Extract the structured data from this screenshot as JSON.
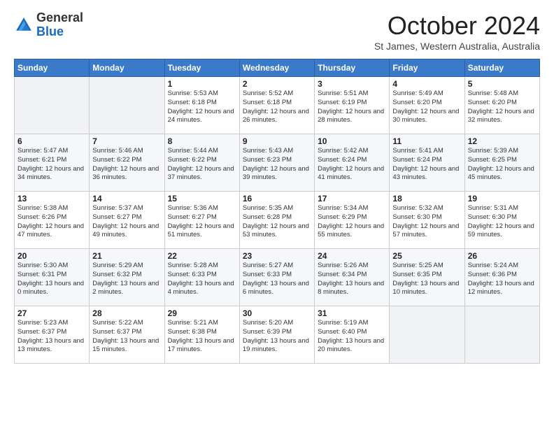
{
  "logo": {
    "general": "General",
    "blue": "Blue"
  },
  "title": "October 2024",
  "location": "St James, Western Australia, Australia",
  "days_header": [
    "Sunday",
    "Monday",
    "Tuesday",
    "Wednesday",
    "Thursday",
    "Friday",
    "Saturday"
  ],
  "weeks": [
    [
      {
        "day": "",
        "info": ""
      },
      {
        "day": "",
        "info": ""
      },
      {
        "day": "1",
        "info": "Sunrise: 5:53 AM\nSunset: 6:18 PM\nDaylight: 12 hours\nand 24 minutes."
      },
      {
        "day": "2",
        "info": "Sunrise: 5:52 AM\nSunset: 6:18 PM\nDaylight: 12 hours\nand 26 minutes."
      },
      {
        "day": "3",
        "info": "Sunrise: 5:51 AM\nSunset: 6:19 PM\nDaylight: 12 hours\nand 28 minutes."
      },
      {
        "day": "4",
        "info": "Sunrise: 5:49 AM\nSunset: 6:20 PM\nDaylight: 12 hours\nand 30 minutes."
      },
      {
        "day": "5",
        "info": "Sunrise: 5:48 AM\nSunset: 6:20 PM\nDaylight: 12 hours\nand 32 minutes."
      }
    ],
    [
      {
        "day": "6",
        "info": "Sunrise: 5:47 AM\nSunset: 6:21 PM\nDaylight: 12 hours\nand 34 minutes."
      },
      {
        "day": "7",
        "info": "Sunrise: 5:46 AM\nSunset: 6:22 PM\nDaylight: 12 hours\nand 36 minutes."
      },
      {
        "day": "8",
        "info": "Sunrise: 5:44 AM\nSunset: 6:22 PM\nDaylight: 12 hours\nand 37 minutes."
      },
      {
        "day": "9",
        "info": "Sunrise: 5:43 AM\nSunset: 6:23 PM\nDaylight: 12 hours\nand 39 minutes."
      },
      {
        "day": "10",
        "info": "Sunrise: 5:42 AM\nSunset: 6:24 PM\nDaylight: 12 hours\nand 41 minutes."
      },
      {
        "day": "11",
        "info": "Sunrise: 5:41 AM\nSunset: 6:24 PM\nDaylight: 12 hours\nand 43 minutes."
      },
      {
        "day": "12",
        "info": "Sunrise: 5:39 AM\nSunset: 6:25 PM\nDaylight: 12 hours\nand 45 minutes."
      }
    ],
    [
      {
        "day": "13",
        "info": "Sunrise: 5:38 AM\nSunset: 6:26 PM\nDaylight: 12 hours\nand 47 minutes."
      },
      {
        "day": "14",
        "info": "Sunrise: 5:37 AM\nSunset: 6:27 PM\nDaylight: 12 hours\nand 49 minutes."
      },
      {
        "day": "15",
        "info": "Sunrise: 5:36 AM\nSunset: 6:27 PM\nDaylight: 12 hours\nand 51 minutes."
      },
      {
        "day": "16",
        "info": "Sunrise: 5:35 AM\nSunset: 6:28 PM\nDaylight: 12 hours\nand 53 minutes."
      },
      {
        "day": "17",
        "info": "Sunrise: 5:34 AM\nSunset: 6:29 PM\nDaylight: 12 hours\nand 55 minutes."
      },
      {
        "day": "18",
        "info": "Sunrise: 5:32 AM\nSunset: 6:30 PM\nDaylight: 12 hours\nand 57 minutes."
      },
      {
        "day": "19",
        "info": "Sunrise: 5:31 AM\nSunset: 6:30 PM\nDaylight: 12 hours\nand 59 minutes."
      }
    ],
    [
      {
        "day": "20",
        "info": "Sunrise: 5:30 AM\nSunset: 6:31 PM\nDaylight: 13 hours\nand 0 minutes."
      },
      {
        "day": "21",
        "info": "Sunrise: 5:29 AM\nSunset: 6:32 PM\nDaylight: 13 hours\nand 2 minutes."
      },
      {
        "day": "22",
        "info": "Sunrise: 5:28 AM\nSunset: 6:33 PM\nDaylight: 13 hours\nand 4 minutes."
      },
      {
        "day": "23",
        "info": "Sunrise: 5:27 AM\nSunset: 6:33 PM\nDaylight: 13 hours\nand 6 minutes."
      },
      {
        "day": "24",
        "info": "Sunrise: 5:26 AM\nSunset: 6:34 PM\nDaylight: 13 hours\nand 8 minutes."
      },
      {
        "day": "25",
        "info": "Sunrise: 5:25 AM\nSunset: 6:35 PM\nDaylight: 13 hours\nand 10 minutes."
      },
      {
        "day": "26",
        "info": "Sunrise: 5:24 AM\nSunset: 6:36 PM\nDaylight: 13 hours\nand 12 minutes."
      }
    ],
    [
      {
        "day": "27",
        "info": "Sunrise: 5:23 AM\nSunset: 6:37 PM\nDaylight: 13 hours\nand 13 minutes."
      },
      {
        "day": "28",
        "info": "Sunrise: 5:22 AM\nSunset: 6:37 PM\nDaylight: 13 hours\nand 15 minutes."
      },
      {
        "day": "29",
        "info": "Sunrise: 5:21 AM\nSunset: 6:38 PM\nDaylight: 13 hours\nand 17 minutes."
      },
      {
        "day": "30",
        "info": "Sunrise: 5:20 AM\nSunset: 6:39 PM\nDaylight: 13 hours\nand 19 minutes."
      },
      {
        "day": "31",
        "info": "Sunrise: 5:19 AM\nSunset: 6:40 PM\nDaylight: 13 hours\nand 20 minutes."
      },
      {
        "day": "",
        "info": ""
      },
      {
        "day": "",
        "info": ""
      }
    ]
  ]
}
